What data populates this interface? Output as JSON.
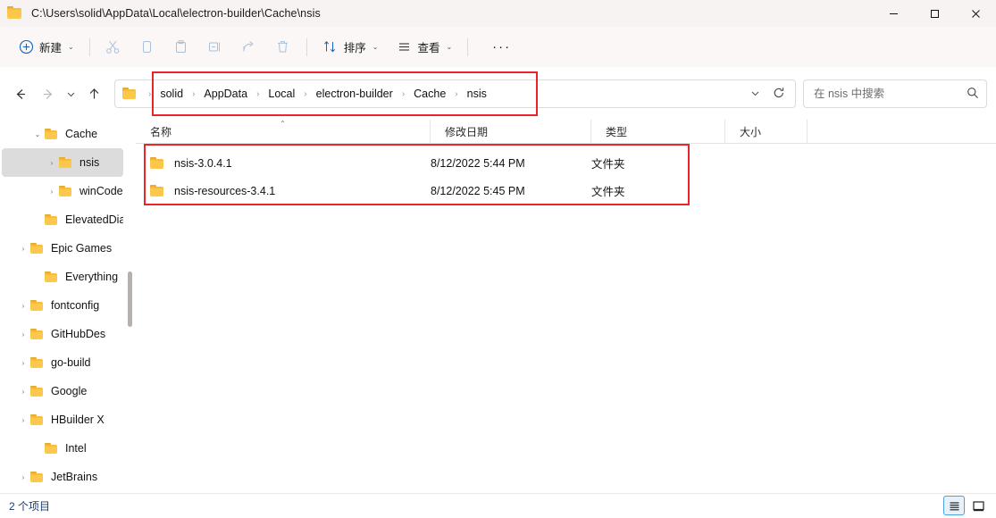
{
  "window": {
    "title": "C:\\Users\\solid\\AppData\\Local\\electron-builder\\Cache\\nsis",
    "minimize_label": "—",
    "maximize_label": "☐",
    "close_label": "✕"
  },
  "toolbar": {
    "new_label": "新建",
    "sort_label": "排序",
    "view_label": "查看",
    "more_label": "···",
    "chevron": "⌄",
    "items": [
      {
        "name": "cut-icon",
        "label": "剪切",
        "disabled": true
      },
      {
        "name": "copy-icon",
        "label": "复制",
        "disabled": true
      },
      {
        "name": "paste-icon",
        "label": "粘贴",
        "disabled": true
      },
      {
        "name": "rename-icon",
        "label": "重命名",
        "disabled": true
      },
      {
        "name": "share-icon",
        "label": "共享",
        "disabled": true
      },
      {
        "name": "delete-icon",
        "label": "删除",
        "disabled": true
      }
    ]
  },
  "navigation": {
    "back": "←",
    "forward": "→",
    "recent": "⌄",
    "up": "↑",
    "refresh": "⟳",
    "dropdown": "⌄"
  },
  "breadcrumb": {
    "separator": "›",
    "crumbs": [
      "solid",
      "AppData",
      "Local",
      "electron-builder",
      "Cache",
      "nsis"
    ]
  },
  "search": {
    "placeholder": "在 nsis 中搜索",
    "value": "",
    "icon": "⌕"
  },
  "sidebar": {
    "expander_open": "⌄",
    "expander_closed": "›",
    "items": [
      {
        "label": "Cache",
        "indent": 2,
        "expander": "open",
        "selected": false
      },
      {
        "label": "nsis",
        "indent": 3,
        "expander": "closed",
        "selected": true
      },
      {
        "label": "winCode",
        "indent": 3,
        "expander": "closed",
        "selected": false
      },
      {
        "label": "ElevatedDia",
        "indent": 2,
        "expander": "none",
        "selected": false
      },
      {
        "label": "Epic Games",
        "indent": 1,
        "expander": "closed",
        "selected": false
      },
      {
        "label": "Everything",
        "indent": 2,
        "expander": "none",
        "selected": false
      },
      {
        "label": "fontconfig",
        "indent": 1,
        "expander": "closed",
        "selected": false
      },
      {
        "label": "GitHubDes",
        "indent": 1,
        "expander": "closed",
        "selected": false
      },
      {
        "label": "go-build",
        "indent": 1,
        "expander": "closed",
        "selected": false
      },
      {
        "label": "Google",
        "indent": 1,
        "expander": "closed",
        "selected": false
      },
      {
        "label": "HBuilder X",
        "indent": 1,
        "expander": "closed",
        "selected": false
      },
      {
        "label": "Intel",
        "indent": 2,
        "expander": "none",
        "selected": false
      },
      {
        "label": "JetBrains",
        "indent": 1,
        "expander": "closed",
        "selected": false
      }
    ]
  },
  "filelist": {
    "sort_indicator": "⌃",
    "columns": [
      {
        "key": "name",
        "label": "名称"
      },
      {
        "key": "date",
        "label": "修改日期"
      },
      {
        "key": "type",
        "label": "类型"
      },
      {
        "key": "size",
        "label": "大小"
      }
    ],
    "rows": [
      {
        "name": "nsis-3.0.4.1",
        "date": "8/12/2022 5:44 PM",
        "type": "文件夹",
        "size": ""
      },
      {
        "name": "nsis-resources-3.4.1",
        "date": "8/12/2022 5:45 PM",
        "type": "文件夹",
        "size": ""
      }
    ]
  },
  "statusbar": {
    "item_count": "2 个项目",
    "view_details_label": "详细信息",
    "view_large_label": "大图标"
  },
  "colors": {
    "annotation": "#e8252a",
    "folder": "#fbc84c",
    "selection": "#dcdcdc",
    "accent": "#4aa3df",
    "titlebar_bg": "#f7f3f2"
  }
}
